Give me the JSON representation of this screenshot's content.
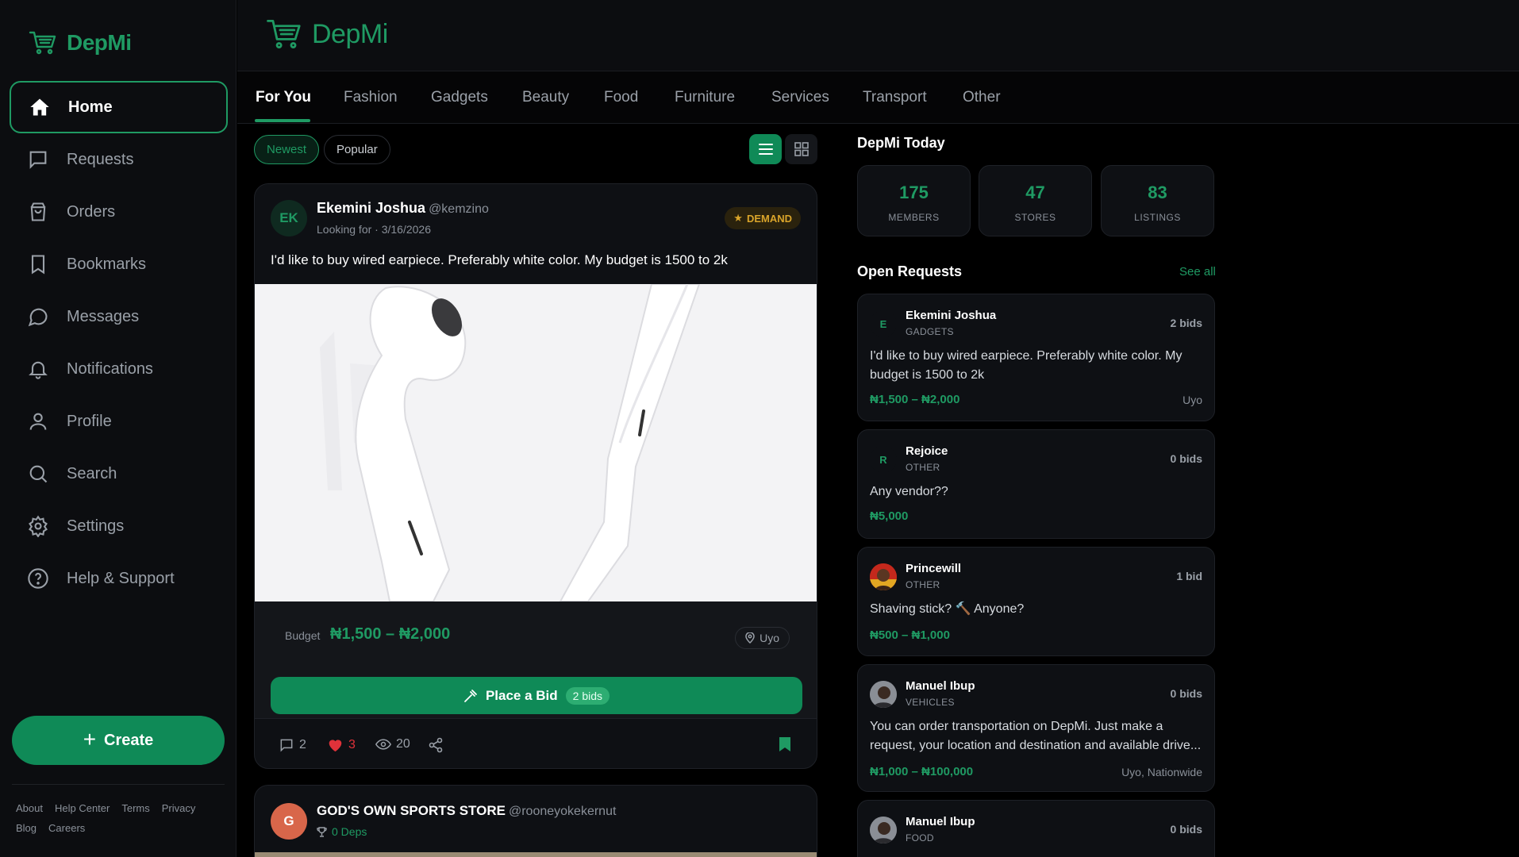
{
  "app": {
    "name": "DepMi"
  },
  "sidebar": {
    "items": [
      {
        "label": "Home",
        "icon": "home-icon"
      },
      {
        "label": "Requests",
        "icon": "chat-square-icon"
      },
      {
        "label": "Orders",
        "icon": "shopping-bag-icon"
      },
      {
        "label": "Bookmarks",
        "icon": "bookmark-icon"
      },
      {
        "label": "Messages",
        "icon": "message-circle-icon"
      },
      {
        "label": "Notifications",
        "icon": "bell-icon"
      },
      {
        "label": "Profile",
        "icon": "user-icon"
      },
      {
        "label": "Search",
        "icon": "search-icon"
      },
      {
        "label": "Settings",
        "icon": "gear-icon"
      },
      {
        "label": "Help & Support",
        "icon": "help-circle-icon"
      }
    ],
    "create_label": "Create",
    "footer_links": [
      "About",
      "Help Center",
      "Terms",
      "Privacy",
      "Blog",
      "Careers"
    ]
  },
  "tabs": [
    "For You",
    "Fashion",
    "Gadgets",
    "Beauty",
    "Food",
    "Furniture",
    "Services",
    "Transport",
    "Other"
  ],
  "filters": {
    "newest": "Newest",
    "popular": "Popular"
  },
  "post": {
    "avatar_initials": "EK",
    "author": "Ekemini Joshua",
    "handle": "@kemzino",
    "subtitle": "Looking for · 3/16/2026",
    "badge": "DEMAND",
    "text": "I'd like to buy wired earpiece. Preferably white color. My budget is 1500 to 2k",
    "budget_label": "Budget",
    "budget_value": "₦1,500 – ₦2,000",
    "location": "Uyo",
    "bid_label": "Place a Bid",
    "bid_count": "2 bids",
    "comments": "2",
    "likes": "3",
    "views": "20"
  },
  "post2": {
    "avatar_initial": "G",
    "author": "GOD'S OWN SPORTS STORE",
    "handle": "@rooneyokekernut",
    "deps": "0 Deps"
  },
  "today": {
    "title": "DepMi Today",
    "stats": [
      {
        "value": "175",
        "label": "MEMBERS"
      },
      {
        "value": "47",
        "label": "STORES"
      },
      {
        "value": "83",
        "label": "LISTINGS"
      }
    ]
  },
  "open_requests": {
    "title": "Open Requests",
    "see_all": "See all",
    "items": [
      {
        "initial": "E",
        "name": "Ekemini Joshua",
        "category": "GADGETS",
        "bids": "2 bids",
        "text": "I'd like to buy wired earpiece. Preferably white color. My budget is 1500 to 2k",
        "price": "₦1,500 – ₦2,000",
        "location": "Uyo"
      },
      {
        "initial": "R",
        "name": "Rejoice",
        "category": "OTHER",
        "bids": "0 bids",
        "text": "Any vendor??",
        "price": "₦5,000",
        "location": ""
      },
      {
        "initial": "",
        "name": "Princewill",
        "category": "OTHER",
        "bids": "1 bid",
        "text": "Shaving stick? 🔨 Anyone?",
        "price": "₦500 – ₦1,000",
        "location": ""
      },
      {
        "initial": "",
        "name": "Manuel Ibup",
        "category": "VEHICLES",
        "bids": "0 bids",
        "text": "You can order transportation on DepMi. Just make a request, your location and destination and available drive...",
        "price": "₦1,000 – ₦100,000",
        "location": "Uyo, Nationwide"
      },
      {
        "initial": "",
        "name": "Manuel Ibup",
        "category": "FOOD",
        "bids": "0 bids",
        "text": "",
        "price": "",
        "location": ""
      }
    ]
  },
  "colors": {
    "accent": "#1f9a63",
    "button": "#0f8a57",
    "demand": "#d9a42a",
    "like": "#e0323a"
  }
}
